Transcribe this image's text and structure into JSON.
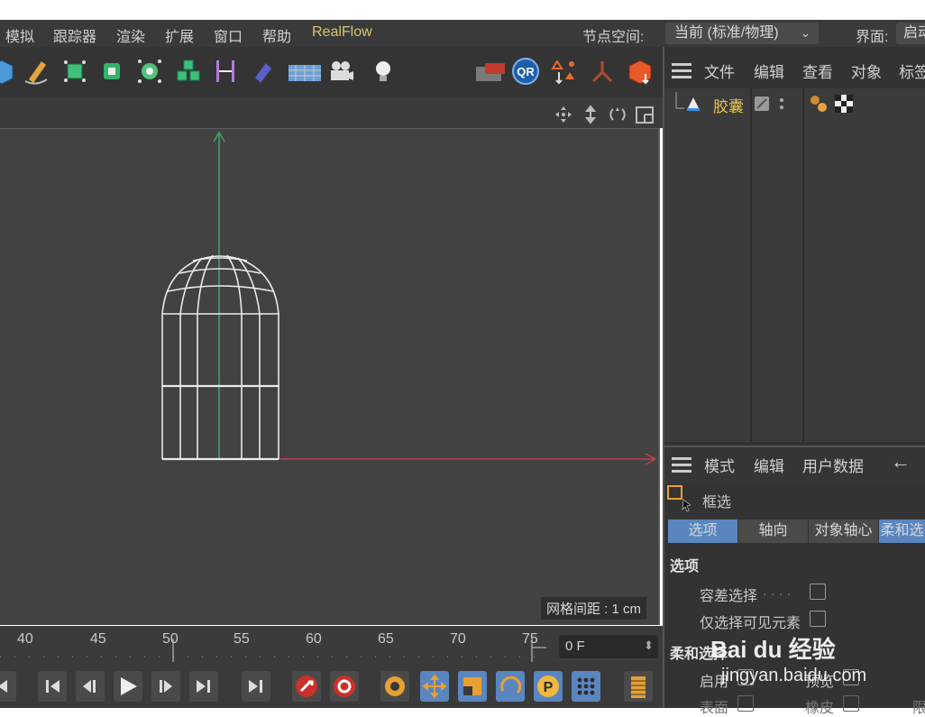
{
  "menubar": {
    "items": [
      "模拟",
      "跟踪器",
      "渲染",
      "扩展",
      "窗口",
      "帮助",
      "RealFlow"
    ],
    "node_space_label": "节点空间:",
    "node_space_value": "当前 (标准/物理)",
    "interface_label": "界面:",
    "interface_value": "启动"
  },
  "toolbar": {
    "icons": [
      "cube-icon",
      "pen-icon",
      "nurbs-icon",
      "array-icon",
      "deformer-icon",
      "cloner-icon",
      "bend-icon",
      "field-icon",
      "floor-icon",
      "camera-icon",
      "light-icon",
      "clapper-icon",
      "qr-icon",
      "mograph-icon",
      "joint-icon",
      "deform-cube-icon"
    ]
  },
  "viewport": {
    "nav_icons": [
      "move-view-icon",
      "zoom-view-icon",
      "rotate-view-icon",
      "maximize-view-icon"
    ],
    "grid_spacing": "网格间距 : 1 cm"
  },
  "timeline": {
    "ticks": [
      "40",
      "45",
      "50",
      "55",
      "60",
      "65",
      "70",
      "75"
    ],
    "current_frame": "0 F"
  },
  "object_manager": {
    "menu": [
      "文件",
      "编辑",
      "查看",
      "对象",
      "标签"
    ],
    "objects": [
      {
        "name": "胶囊"
      }
    ]
  },
  "attribute_manager": {
    "menu": [
      "模式",
      "编辑",
      "用户数据"
    ],
    "tool_name": "框选",
    "tabs": [
      "选项",
      "轴向",
      "对象轴心",
      "柔和选"
    ],
    "section_options": "选项",
    "tolerance_label": "容差选择",
    "visible_only_label": "仅选择可见元素",
    "section_soft": "柔和选择",
    "enable_label": "启用",
    "preview_label": "预览",
    "surface_label": "表面",
    "rubber_label": "橡皮",
    "limit_label": "限"
  },
  "watermark": {
    "brand": "Bai du 经验",
    "url": "jingyan.baidu.com"
  },
  "colors": {
    "y_axis": "#3fa46a",
    "x_axis": "#c0404a",
    "accent_tab": "#5a86c0",
    "highlight_object": "#e8c34a"
  }
}
